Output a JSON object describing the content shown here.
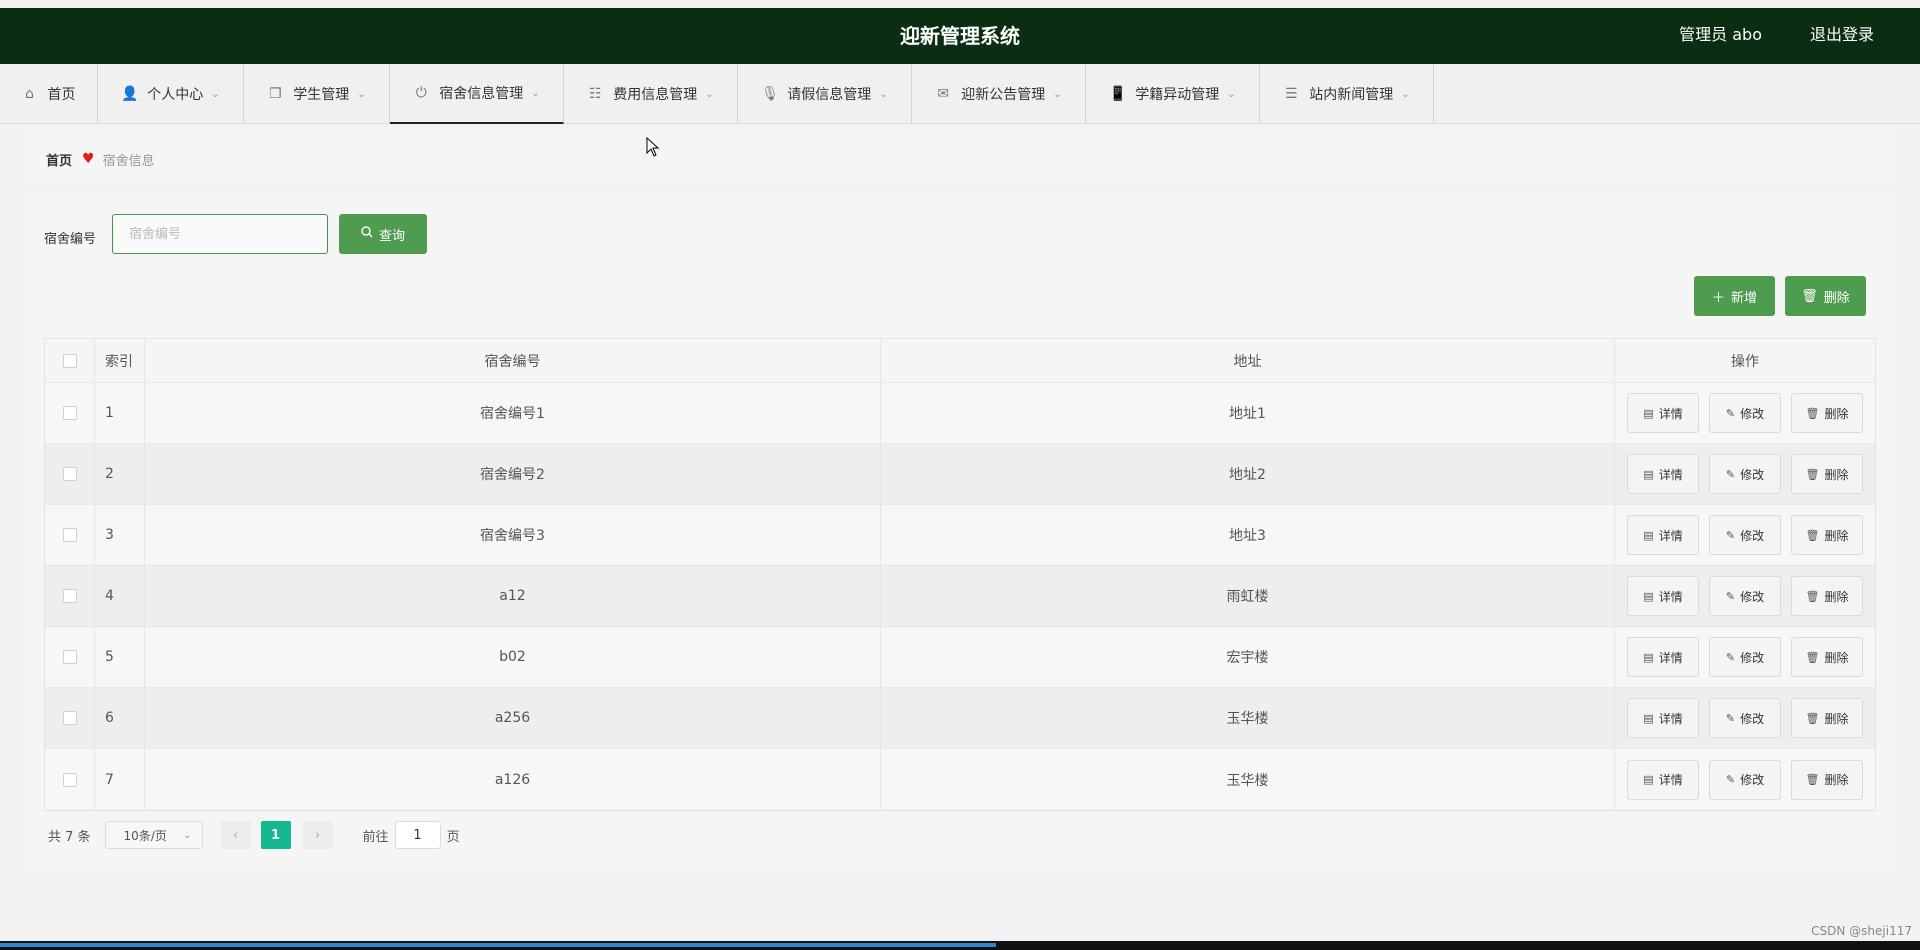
{
  "header": {
    "title": "迎新管理系统",
    "user": "管理员 abo",
    "logout": "退出登录"
  },
  "nav": [
    {
      "label": "首页",
      "icon": "home-icon",
      "glyph": "⌂",
      "chevron": false
    },
    {
      "label": "个人中心",
      "icon": "user-icon",
      "glyph": "👤",
      "chevron": true
    },
    {
      "label": "学生管理",
      "icon": "copy-icon",
      "glyph": "❐",
      "chevron": true
    },
    {
      "label": "宿舍信息管理",
      "icon": "power-icon",
      "glyph": "⏻",
      "chevron": true,
      "active": true
    },
    {
      "label": "费用信息管理",
      "icon": "sliders-icon",
      "glyph": "☷",
      "chevron": true
    },
    {
      "label": "请假信息管理",
      "icon": "microphone-icon",
      "glyph": "🎙",
      "chevron": true
    },
    {
      "label": "迎新公告管理",
      "icon": "mail-icon",
      "glyph": "✉",
      "chevron": true
    },
    {
      "label": "学籍异动管理",
      "icon": "phone-icon",
      "glyph": "📱",
      "chevron": true
    },
    {
      "label": "站内新闻管理",
      "icon": "list-icon",
      "glyph": "☰",
      "chevron": true
    }
  ],
  "breadcrumb": {
    "home": "首页",
    "current": "宿舍信息"
  },
  "search": {
    "label": "宿舍编号",
    "placeholder": "宿舍编号",
    "button": "查询"
  },
  "actions": {
    "add": "新增",
    "delete": "删除"
  },
  "table": {
    "headers": {
      "index": "索引",
      "no": "宿舍编号",
      "address": "地址",
      "ops": "操作"
    },
    "rows": [
      {
        "index": "1",
        "no": "宿舍编号1",
        "address": "地址1"
      },
      {
        "index": "2",
        "no": "宿舍编号2",
        "address": "地址2"
      },
      {
        "index": "3",
        "no": "宿舍编号3",
        "address": "地址3"
      },
      {
        "index": "4",
        "no": "a12",
        "address": "雨虹楼"
      },
      {
        "index": "5",
        "no": "b02",
        "address": "宏宇楼"
      },
      {
        "index": "6",
        "no": "a256",
        "address": "玉华楼"
      },
      {
        "index": "7",
        "no": "a126",
        "address": "玉华楼"
      }
    ],
    "row_ops": {
      "detail": "详情",
      "edit": "修改",
      "delete": "删除"
    }
  },
  "pager": {
    "total": "共 7 条",
    "page_size": "10条/页",
    "current": "1",
    "goto_prefix": "前往",
    "goto_value": "1",
    "goto_suffix": "页"
  },
  "watermark": "CSDN @sheji117",
  "colors": {
    "header_bg": "#0b2e12",
    "primary_green": "#4f9b4f",
    "page_active": "#16b98f"
  }
}
